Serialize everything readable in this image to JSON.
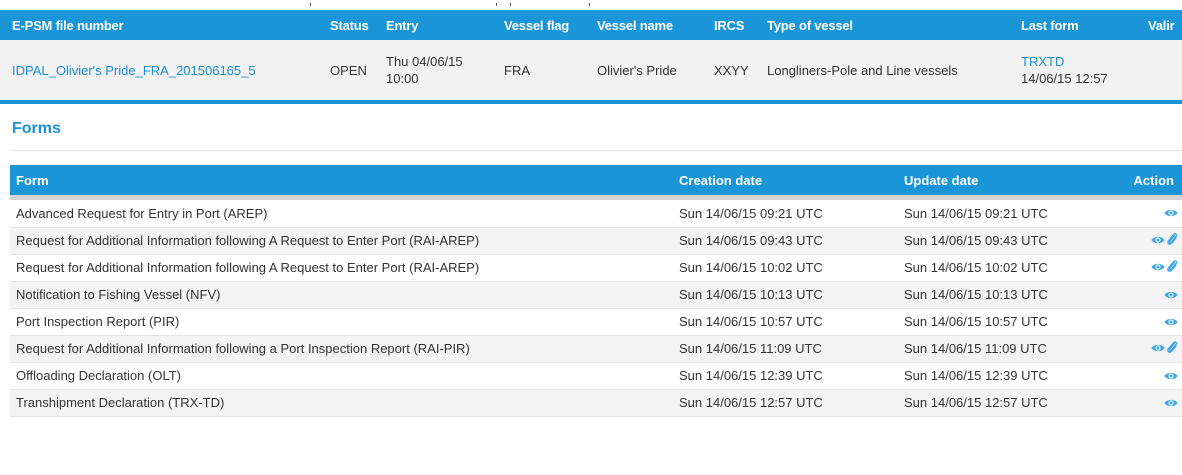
{
  "vessel_table": {
    "headers": {
      "file_number": "E-PSM file number",
      "status": "Status",
      "entry": "Entry",
      "vessel_flag": "Vessel flag",
      "vessel_name": "Vessel name",
      "ircs": "IRCS",
      "type_of_vessel": "Type of vessel",
      "last_form": "Last form",
      "validation": "Valir"
    },
    "row": {
      "file_number": "IDPAL_Olivier's Pride_FRA_201506165_5",
      "status": "OPEN",
      "entry_line1": "Thu 04/06/15",
      "entry_line2": "10:00",
      "vessel_flag": "FRA",
      "vessel_name": "Olivier's Pride",
      "ircs": "XXYY",
      "type_of_vessel": "Longliners-Pole and Line vessels",
      "last_form_code": "TRXTD",
      "last_form_date": "14/06/15 12:57"
    }
  },
  "forms_section": {
    "heading": "Forms",
    "headers": {
      "form": "Form",
      "creation_date": "Creation date",
      "update_date": "Update date",
      "action": "Action"
    },
    "rows": [
      {
        "form": "Advanced Request for Entry in Port (AREP)",
        "creation_date": "Sun 14/06/15 09:21 UTC",
        "update_date": "Sun 14/06/15 09:21 UTC",
        "icons": [
          "eye-icon"
        ]
      },
      {
        "form": "Request for Additional Information following A Request to Enter Port (RAI-AREP)",
        "creation_date": "Sun 14/06/15 09:43 UTC",
        "update_date": "Sun 14/06/15 09:43 UTC",
        "icons": [
          "eye-icon",
          "paperclip-icon"
        ]
      },
      {
        "form": "Request for Additional Information following A Request to Enter Port (RAI-AREP)",
        "creation_date": "Sun 14/06/15 10:02 UTC",
        "update_date": "Sun 14/06/15 10:02 UTC",
        "icons": [
          "eye-icon",
          "paperclip-icon"
        ]
      },
      {
        "form": "Notification to Fishing Vessel (NFV)",
        "creation_date": "Sun 14/06/15 10:13 UTC",
        "update_date": "Sun 14/06/15 10:13 UTC",
        "icons": [
          "eye-icon"
        ]
      },
      {
        "form": "Port Inspection Report (PIR)",
        "creation_date": "Sun 14/06/15 10:57 UTC",
        "update_date": "Sun 14/06/15 10:57 UTC",
        "icons": [
          "eye-icon"
        ]
      },
      {
        "form": "Request for Additional Information following a Port Inspection Report (RAI-PIR)",
        "creation_date": "Sun 14/06/15 11:09 UTC",
        "update_date": "Sun 14/06/15 11:09 UTC",
        "icons": [
          "eye-icon",
          "paperclip-icon"
        ]
      },
      {
        "form": "Offloading Declaration (OLT)",
        "creation_date": "Sun 14/06/15 12:39 UTC",
        "update_date": "Sun 14/06/15 12:39 UTC",
        "icons": [
          "eye-icon"
        ]
      },
      {
        "form": "Transhipment Declaration (TRX-TD)",
        "creation_date": "Sun 14/06/15 12:57 UTC",
        "update_date": "Sun 14/06/15 12:57 UTC",
        "icons": [
          "eye-icon"
        ]
      }
    ]
  },
  "colors": {
    "header_blue": "#1995d8",
    "link_blue": "#1a8fd6",
    "icon_blue": "#3aa6e3"
  }
}
